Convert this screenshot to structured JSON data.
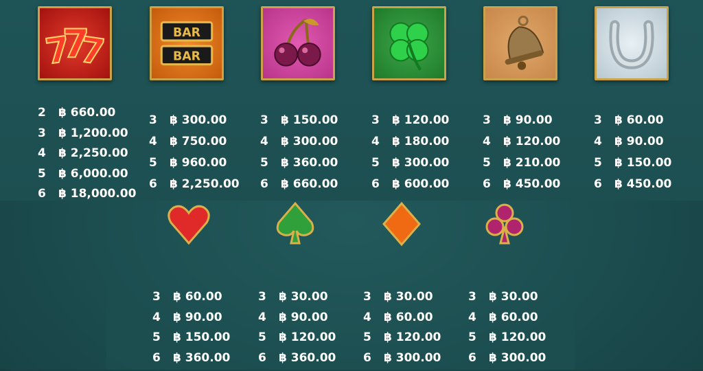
{
  "symbols": [
    {
      "name": "seven",
      "icon": "triple-seven-icon",
      "pays": [
        {
          "count": "2",
          "amount": "฿ 660.00"
        },
        {
          "count": "3",
          "amount": "฿ 1,200.00"
        },
        {
          "count": "4",
          "amount": "฿ 2,250.00"
        },
        {
          "count": "5",
          "amount": "฿ 6,000.00"
        },
        {
          "count": "6",
          "amount": "฿ 18,000.00"
        }
      ]
    },
    {
      "name": "bar",
      "icon": "bar-icon",
      "label_top": "BAR",
      "label_bottom": "BAR",
      "pays": [
        {
          "count": "3",
          "amount": "฿ 300.00"
        },
        {
          "count": "4",
          "amount": "฿ 750.00"
        },
        {
          "count": "5",
          "amount": "฿ 960.00"
        },
        {
          "count": "6",
          "amount": "฿ 2,250.00"
        }
      ]
    },
    {
      "name": "cherry",
      "icon": "cherry-icon",
      "pays": [
        {
          "count": "3",
          "amount": "฿ 150.00"
        },
        {
          "count": "4",
          "amount": "฿ 300.00"
        },
        {
          "count": "5",
          "amount": "฿ 360.00"
        },
        {
          "count": "6",
          "amount": "฿ 660.00"
        }
      ]
    },
    {
      "name": "clover",
      "icon": "four-leaf-clover-icon",
      "pays": [
        {
          "count": "3",
          "amount": "฿ 120.00"
        },
        {
          "count": "4",
          "amount": "฿ 180.00"
        },
        {
          "count": "5",
          "amount": "฿ 300.00"
        },
        {
          "count": "6",
          "amount": "฿ 600.00"
        }
      ]
    },
    {
      "name": "bell",
      "icon": "bell-icon",
      "pays": [
        {
          "count": "3",
          "amount": "฿ 90.00"
        },
        {
          "count": "4",
          "amount": "฿ 120.00"
        },
        {
          "count": "5",
          "amount": "฿ 210.00"
        },
        {
          "count": "6",
          "amount": "฿ 450.00"
        }
      ]
    },
    {
      "name": "horseshoe",
      "icon": "horseshoe-icon",
      "pays": [
        {
          "count": "3",
          "amount": "฿ 60.00"
        },
        {
          "count": "4",
          "amount": "฿ 90.00"
        },
        {
          "count": "5",
          "amount": "฿ 150.00"
        },
        {
          "count": "6",
          "amount": "฿ 450.00"
        }
      ]
    }
  ],
  "suits": [
    {
      "name": "heart",
      "icon": "heart-icon",
      "color": "#e02a2a",
      "pays": [
        {
          "count": "3",
          "amount": "฿ 60.00"
        },
        {
          "count": "4",
          "amount": "฿ 90.00"
        },
        {
          "count": "5",
          "amount": "฿ 150.00"
        },
        {
          "count": "6",
          "amount": "฿ 360.00"
        }
      ]
    },
    {
      "name": "spade",
      "icon": "spade-icon",
      "color": "#2fa03a",
      "pays": [
        {
          "count": "3",
          "amount": "฿ 30.00"
        },
        {
          "count": "4",
          "amount": "฿ 90.00"
        },
        {
          "count": "5",
          "amount": "฿ 120.00"
        },
        {
          "count": "6",
          "amount": "฿ 360.00"
        }
      ]
    },
    {
      "name": "diamond",
      "icon": "diamond-icon",
      "color": "#f06a14",
      "pays": [
        {
          "count": "3",
          "amount": "฿ 30.00"
        },
        {
          "count": "4",
          "amount": "฿ 60.00"
        },
        {
          "count": "5",
          "amount": "฿ 120.00"
        },
        {
          "count": "6",
          "amount": "฿ 300.00"
        }
      ]
    },
    {
      "name": "club",
      "icon": "club-icon",
      "color": "#b0246e",
      "pays": [
        {
          "count": "3",
          "amount": "฿ 30.00"
        },
        {
          "count": "4",
          "amount": "฿ 60.00"
        },
        {
          "count": "5",
          "amount": "฿ 120.00"
        },
        {
          "count": "6",
          "amount": "฿ 300.00"
        }
      ]
    }
  ],
  "colors": {
    "background": "#1d4f51",
    "gold_border": "#c9a24a",
    "text": "#ffffff"
  }
}
